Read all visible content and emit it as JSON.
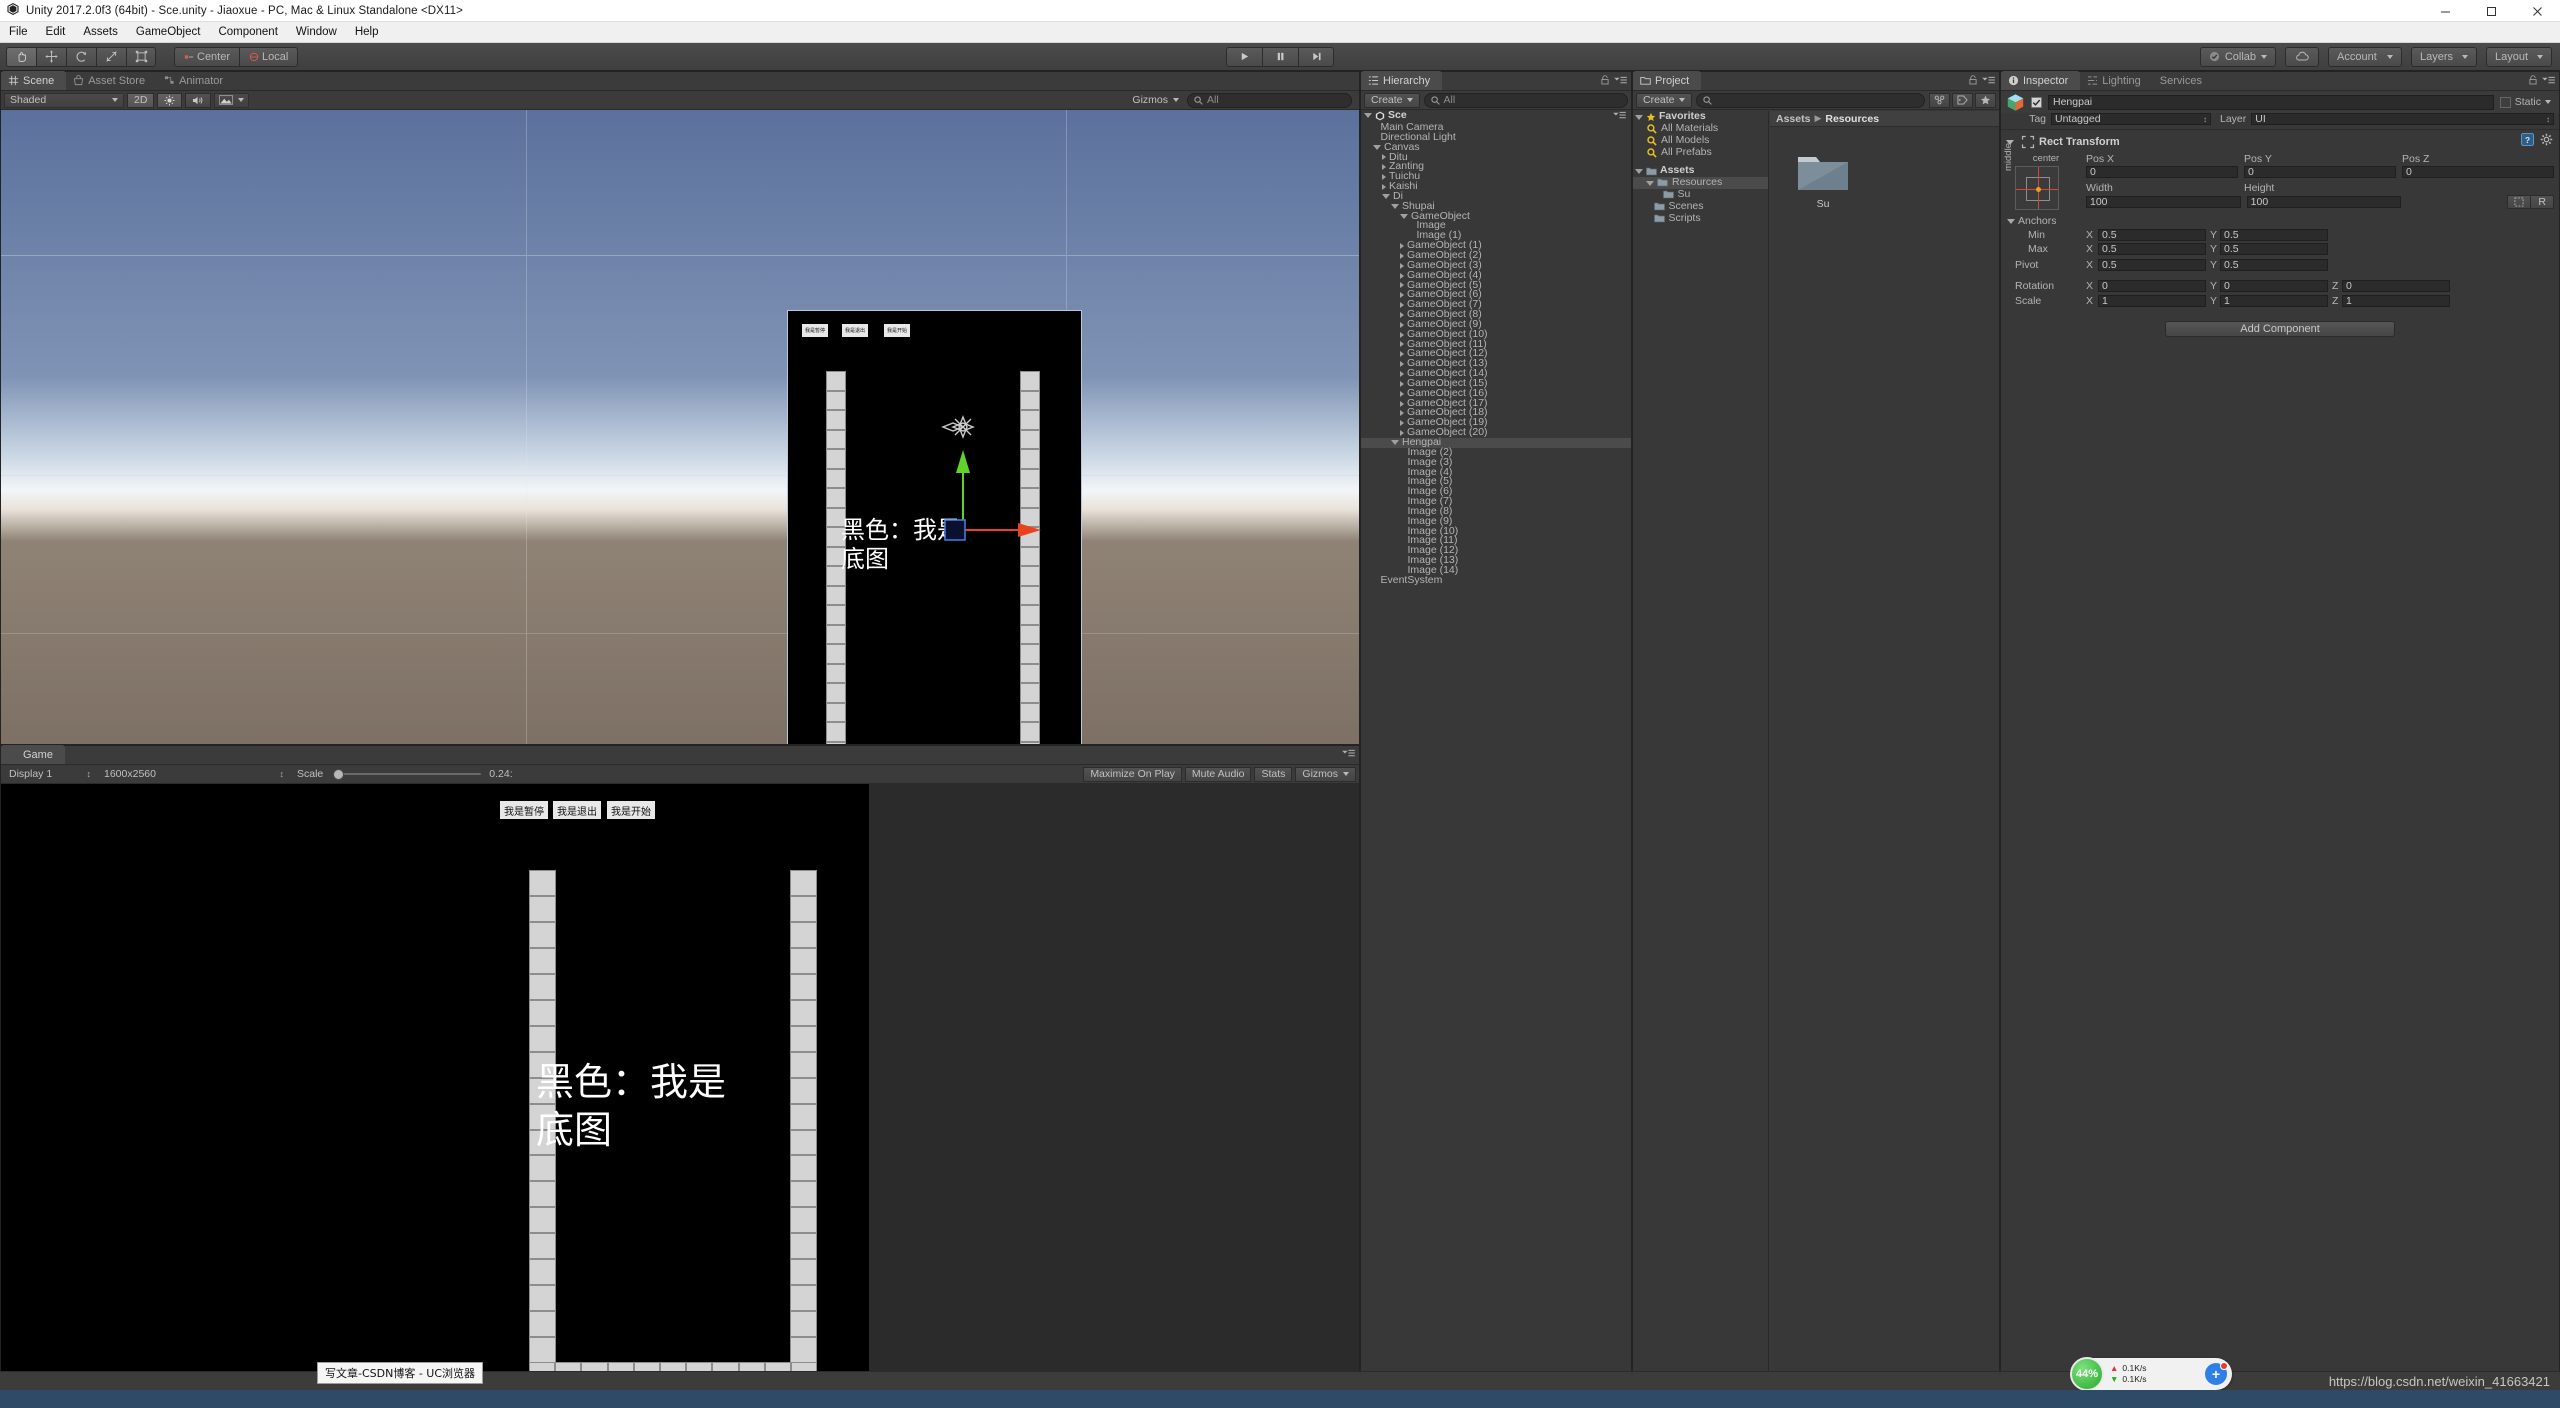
{
  "window": {
    "title": "Unity 2017.2.0f3 (64bit) - Sce.unity - Jiaoxue - PC, Mac & Linux Standalone <DX11>",
    "minimize": "minimize-icon",
    "maximize": "maximize-icon",
    "close": "close-icon"
  },
  "menubar": {
    "items": [
      "File",
      "Edit",
      "Assets",
      "GameObject",
      "Component",
      "Window",
      "Help"
    ]
  },
  "toolbar": {
    "tools": [
      "hand-tool",
      "move-tool",
      "rotate-tool",
      "scale-tool",
      "rect-tool"
    ],
    "pivot_mode": "Center",
    "pivot_rotation": "Local",
    "play": "play-icon",
    "pause": "pause-icon",
    "step": "step-icon",
    "collab": "Collab",
    "cloud": "cloud-icon",
    "account": "Account",
    "layers": "Layers",
    "layout": "Layout"
  },
  "scene_view": {
    "tabs": [
      {
        "label": "Scene",
        "icon": "scene-icon",
        "active": true
      },
      {
        "label": "Asset Store",
        "icon": "store-icon",
        "active": false
      },
      {
        "label": "Animator",
        "icon": "animator-icon",
        "active": false
      }
    ],
    "draw_mode": "Shaded",
    "two_d": "2D",
    "lighting_toggle": "lighting-icon",
    "audio_toggle": "audio-icon",
    "effects_toggle": "effects-icon",
    "gizmos": "Gizmos",
    "search_placeholder": "All",
    "canvas_buttons": [
      "我是暂停",
      "我是退出",
      "我是开始"
    ],
    "canvas_text_line1": "黑色：我是",
    "canvas_text_line2": "底图"
  },
  "game_view": {
    "tab": "Game",
    "display": "Display 1",
    "resolution": "1600x2560",
    "scale_label": "Scale",
    "scale_value": "0.24:",
    "maximize_on_play": "Maximize On Play",
    "mute_audio": "Mute Audio",
    "stats": "Stats",
    "gizmos": "Gizmos",
    "canvas_buttons": [
      "我是暂停",
      "我是退出",
      "我是开始"
    ],
    "canvas_text_line1": "黑色：我是",
    "canvas_text_line2": "底图"
  },
  "hierarchy": {
    "tab": "Hierarchy",
    "create": "Create",
    "search_placeholder": "All",
    "scene_name": "Sce",
    "items": [
      {
        "label": "Main Camera",
        "depth": 1,
        "arrow": "none",
        "sel": false
      },
      {
        "label": "Directional Light",
        "depth": 1,
        "arrow": "none",
        "sel": false
      },
      {
        "label": "Canvas",
        "depth": 1,
        "arrow": "open",
        "sel": false
      },
      {
        "label": "Ditu",
        "depth": 2,
        "arrow": "closed",
        "sel": false
      },
      {
        "label": "Zanting",
        "depth": 2,
        "arrow": "closed",
        "sel": false
      },
      {
        "label": "Tuichu",
        "depth": 2,
        "arrow": "closed",
        "sel": false
      },
      {
        "label": "Kaishi",
        "depth": 2,
        "arrow": "closed",
        "sel": false
      },
      {
        "label": "Di",
        "depth": 2,
        "arrow": "open",
        "sel": false
      },
      {
        "label": "Shupai",
        "depth": 3,
        "arrow": "open",
        "sel": false
      },
      {
        "label": "GameObject",
        "depth": 4,
        "arrow": "open",
        "sel": false
      },
      {
        "label": "Image",
        "depth": 5,
        "arrow": "none",
        "sel": false
      },
      {
        "label": "Image (1)",
        "depth": 5,
        "arrow": "none",
        "sel": false
      },
      {
        "label": "GameObject (1)",
        "depth": 4,
        "arrow": "closed",
        "sel": false
      },
      {
        "label": "GameObject (2)",
        "depth": 4,
        "arrow": "closed",
        "sel": false
      },
      {
        "label": "GameObject (3)",
        "depth": 4,
        "arrow": "closed",
        "sel": false
      },
      {
        "label": "GameObject (4)",
        "depth": 4,
        "arrow": "closed",
        "sel": false
      },
      {
        "label": "GameObject (5)",
        "depth": 4,
        "arrow": "closed",
        "sel": false
      },
      {
        "label": "GameObject (6)",
        "depth": 4,
        "arrow": "closed",
        "sel": false
      },
      {
        "label": "GameObject (7)",
        "depth": 4,
        "arrow": "closed",
        "sel": false
      },
      {
        "label": "GameObject (8)",
        "depth": 4,
        "arrow": "closed",
        "sel": false
      },
      {
        "label": "GameObject (9)",
        "depth": 4,
        "arrow": "closed",
        "sel": false
      },
      {
        "label": "GameObject (10)",
        "depth": 4,
        "arrow": "closed",
        "sel": false
      },
      {
        "label": "GameObject (11)",
        "depth": 4,
        "arrow": "closed",
        "sel": false
      },
      {
        "label": "GameObject (12)",
        "depth": 4,
        "arrow": "closed",
        "sel": false
      },
      {
        "label": "GameObject (13)",
        "depth": 4,
        "arrow": "closed",
        "sel": false
      },
      {
        "label": "GameObject (14)",
        "depth": 4,
        "arrow": "closed",
        "sel": false
      },
      {
        "label": "GameObject (15)",
        "depth": 4,
        "arrow": "closed",
        "sel": false
      },
      {
        "label": "GameObject (16)",
        "depth": 4,
        "arrow": "closed",
        "sel": false
      },
      {
        "label": "GameObject (17)",
        "depth": 4,
        "arrow": "closed",
        "sel": false
      },
      {
        "label": "GameObject (18)",
        "depth": 4,
        "arrow": "closed",
        "sel": false
      },
      {
        "label": "GameObject (19)",
        "depth": 4,
        "arrow": "closed",
        "sel": false
      },
      {
        "label": "GameObject (20)",
        "depth": 4,
        "arrow": "closed",
        "sel": false
      },
      {
        "label": "Hengpai",
        "depth": 3,
        "arrow": "open",
        "sel": true
      },
      {
        "label": "Image (2)",
        "depth": 4,
        "arrow": "none",
        "sel": false
      },
      {
        "label": "Image (3)",
        "depth": 4,
        "arrow": "none",
        "sel": false
      },
      {
        "label": "Image (4)",
        "depth": 4,
        "arrow": "none",
        "sel": false
      },
      {
        "label": "Image (5)",
        "depth": 4,
        "arrow": "none",
        "sel": false
      },
      {
        "label": "Image (6)",
        "depth": 4,
        "arrow": "none",
        "sel": false
      },
      {
        "label": "Image (7)",
        "depth": 4,
        "arrow": "none",
        "sel": false
      },
      {
        "label": "Image (8)",
        "depth": 4,
        "arrow": "none",
        "sel": false
      },
      {
        "label": "Image (9)",
        "depth": 4,
        "arrow": "none",
        "sel": false
      },
      {
        "label": "Image (10)",
        "depth": 4,
        "arrow": "none",
        "sel": false
      },
      {
        "label": "Image (11)",
        "depth": 4,
        "arrow": "none",
        "sel": false
      },
      {
        "label": "Image (12)",
        "depth": 4,
        "arrow": "none",
        "sel": false
      },
      {
        "label": "Image (13)",
        "depth": 4,
        "arrow": "none",
        "sel": false
      },
      {
        "label": "Image (14)",
        "depth": 4,
        "arrow": "none",
        "sel": false
      },
      {
        "label": "EventSystem",
        "depth": 1,
        "arrow": "none",
        "sel": false
      }
    ]
  },
  "project": {
    "tab": "Project",
    "create": "Create",
    "search_placeholder": "",
    "favorites_label": "Favorites",
    "favorites": [
      "All Materials",
      "All Models",
      "All Prefabs"
    ],
    "assets_label": "Assets",
    "folders": [
      {
        "label": "Resources",
        "depth": 1,
        "arrow": "open",
        "sel": true
      },
      {
        "label": "Su",
        "depth": 2,
        "arrow": "none",
        "sel": false
      },
      {
        "label": "Scenes",
        "depth": 1,
        "arrow": "none",
        "sel": false
      },
      {
        "label": "Scripts",
        "depth": 1,
        "arrow": "none",
        "sel": false
      }
    ],
    "breadcrumb": [
      "Assets",
      "Resources"
    ],
    "grid_items": [
      {
        "label": "Su",
        "icon": "folder-icon"
      }
    ]
  },
  "inspector": {
    "tabs": [
      {
        "label": "Inspector",
        "icon": "info-icon",
        "active": true
      },
      {
        "label": "Lighting",
        "icon": "lighting-icon",
        "active": false
      },
      {
        "label": "Services",
        "icon": "",
        "active": false
      }
    ],
    "object_name": "Hengpai",
    "enabled": true,
    "static_label": "Static",
    "tag_label": "Tag",
    "tag_value": "Untagged",
    "layer_label": "Layer",
    "layer_value": "UI",
    "component": {
      "title": "Rect Transform",
      "anchor_preset_h": "center",
      "anchor_preset_v": "middle",
      "fields": [
        {
          "label": "Pos X",
          "value": "0"
        },
        {
          "label": "Pos Y",
          "value": "0"
        },
        {
          "label": "Pos Z",
          "value": "0"
        },
        {
          "label": "Width",
          "value": "100"
        },
        {
          "label": "Height",
          "value": "100"
        }
      ],
      "anchors_label": "Anchors",
      "min_label": "Min",
      "min_x": "0.5",
      "min_y": "0.5",
      "max_label": "Max",
      "max_x": "0.5",
      "max_y": "0.5",
      "pivot_label": "Pivot",
      "pivot_x": "0.5",
      "pivot_y": "0.5",
      "rotation_label": "Rotation",
      "rot_x": "0",
      "rot_y": "0",
      "rot_z": "0",
      "scale_label": "Scale",
      "scale_x": "1",
      "scale_y": "1",
      "scale_z": "1",
      "blueprint_btn": "blueprint-mode-icon",
      "raw_btn": "R"
    },
    "add_component": "Add Component"
  },
  "statusbar": {
    "taskbar_tooltip": "写文章-CSDN博客 - UC浏览器",
    "net_percent": "44%",
    "net_up": "0.1K/s",
    "net_down": "0.1K/s",
    "watermark": "https://blog.csdn.net/weixin_41663421"
  },
  "colors": {
    "panel": "#383838",
    "panel_dark": "#2b2b2b",
    "tab_active": "#4b4b4b",
    "text": "#b4b4b4",
    "accent_green": "#3ec73e",
    "accent_red": "#e8431f",
    "sky_top": "#5b719c",
    "sky_horizon": "#dfe7f0",
    "ground": "#7e7468"
  }
}
